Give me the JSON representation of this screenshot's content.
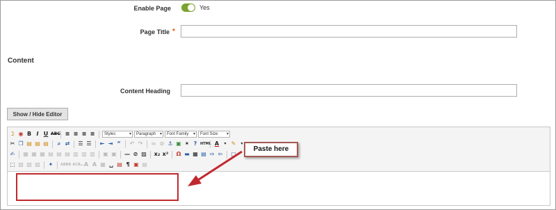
{
  "form": {
    "enable_page": {
      "label": "Enable Page",
      "value": "Yes"
    },
    "page_title": {
      "label": "Page Title",
      "required_marker": "*",
      "value": ""
    },
    "section_title": "Content",
    "content_heading": {
      "label": "Content Heading",
      "value": ""
    },
    "toggle_editor_button": "Show / Hide Editor"
  },
  "editor": {
    "dropdowns": {
      "styles": "Styles",
      "paragraph": "Paragraph",
      "font_family": "Font Family",
      "font_size": "Font Size"
    }
  },
  "annotation": {
    "callout_text": "Paste here"
  },
  "colors": {
    "toggle_on": "#79a22e",
    "required": "#eb5202",
    "highlight_red": "#c0282d",
    "callout_border": "#a35a52"
  }
}
